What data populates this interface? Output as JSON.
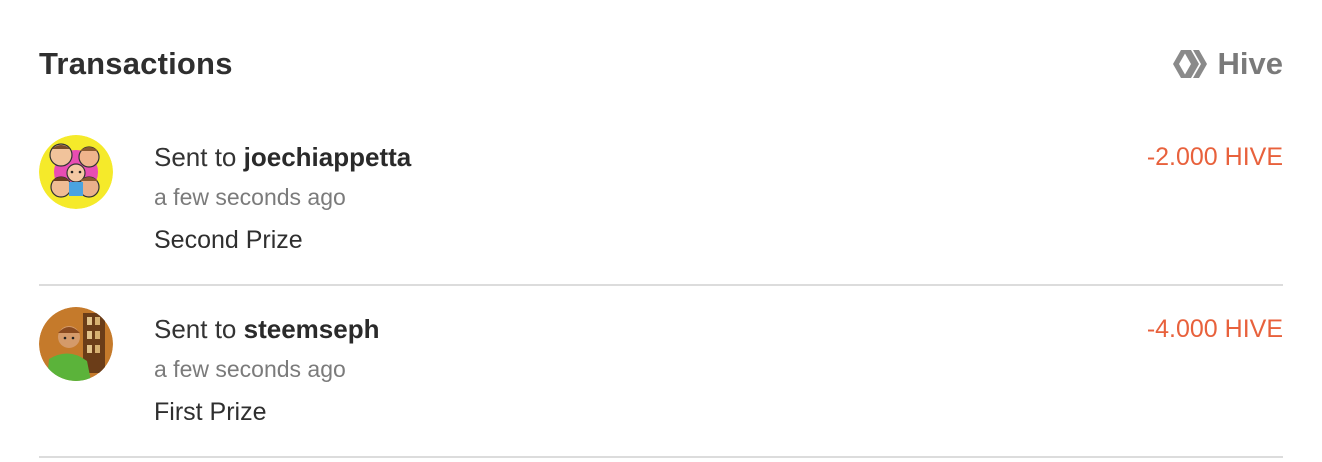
{
  "header": {
    "title": "Transactions",
    "brand_label": "Hive",
    "brand_icon": "hive-logo-icon"
  },
  "colors": {
    "amount_negative": "#e8613c",
    "muted": "#7b7b7b",
    "divider": "#dcdcdc"
  },
  "transactions": [
    {
      "prefix": "Sent to",
      "user": "joechiappetta",
      "time": "a few seconds ago",
      "memo": "Second Prize",
      "amount": "-2.000 HIVE",
      "avatar": "user-avatar-icon"
    },
    {
      "prefix": "Sent to",
      "user": "steemseph",
      "time": "a few seconds ago",
      "memo": "First Prize",
      "amount": "-4.000 HIVE",
      "avatar": "user-avatar-icon"
    }
  ]
}
